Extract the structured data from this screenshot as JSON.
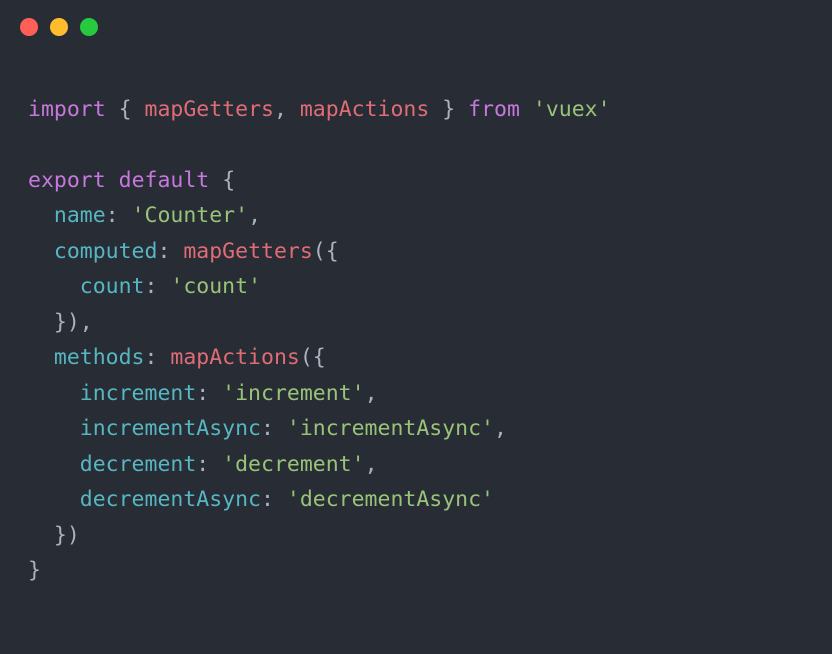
{
  "titlebar": {
    "red": "close",
    "yellow": "minimize",
    "green": "zoom"
  },
  "code": {
    "ln1": {
      "import": "import",
      "lbrace": " { ",
      "mapGetters": "mapGetters",
      "comma1": ", ",
      "mapActions": "mapActions",
      "rbrace": " } ",
      "from": "from",
      "sp": " ",
      "vuex": "'vuex'"
    },
    "ln3": {
      "export": "export",
      "sp1": " ",
      "default": "default",
      "sp2": " ",
      "lbrace": "{"
    },
    "ln4": {
      "indent": "  ",
      "name": "name",
      "colon": ": ",
      "val": "'Counter'",
      "comma": ","
    },
    "ln5": {
      "indent": "  ",
      "computed": "computed",
      "colon": ": ",
      "mapGetters": "mapGetters",
      "lparen": "({"
    },
    "ln6": {
      "indent": "    ",
      "count": "count",
      "colon": ": ",
      "val": "'count'"
    },
    "ln7": {
      "indent": "  ",
      "close": "}),"
    },
    "ln8": {
      "indent": "  ",
      "methods": "methods",
      "colon": ": ",
      "mapActions": "mapActions",
      "lparen": "({"
    },
    "ln9": {
      "indent": "    ",
      "increment": "increment",
      "colon": ": ",
      "val": "'increment'",
      "comma": ","
    },
    "ln10": {
      "indent": "    ",
      "incrementAsync": "incrementAsync",
      "colon": ": ",
      "val": "'incrementAsync'",
      "comma": ","
    },
    "ln11": {
      "indent": "    ",
      "decrement": "decrement",
      "colon": ": ",
      "val": "'decrement'",
      "comma": ","
    },
    "ln12": {
      "indent": "    ",
      "decrementAsync": "decrementAsync",
      "colon": ": ",
      "val": "'decrementAsync'"
    },
    "ln13": {
      "indent": "  ",
      "close": "})"
    },
    "ln14": {
      "close": "}"
    }
  }
}
